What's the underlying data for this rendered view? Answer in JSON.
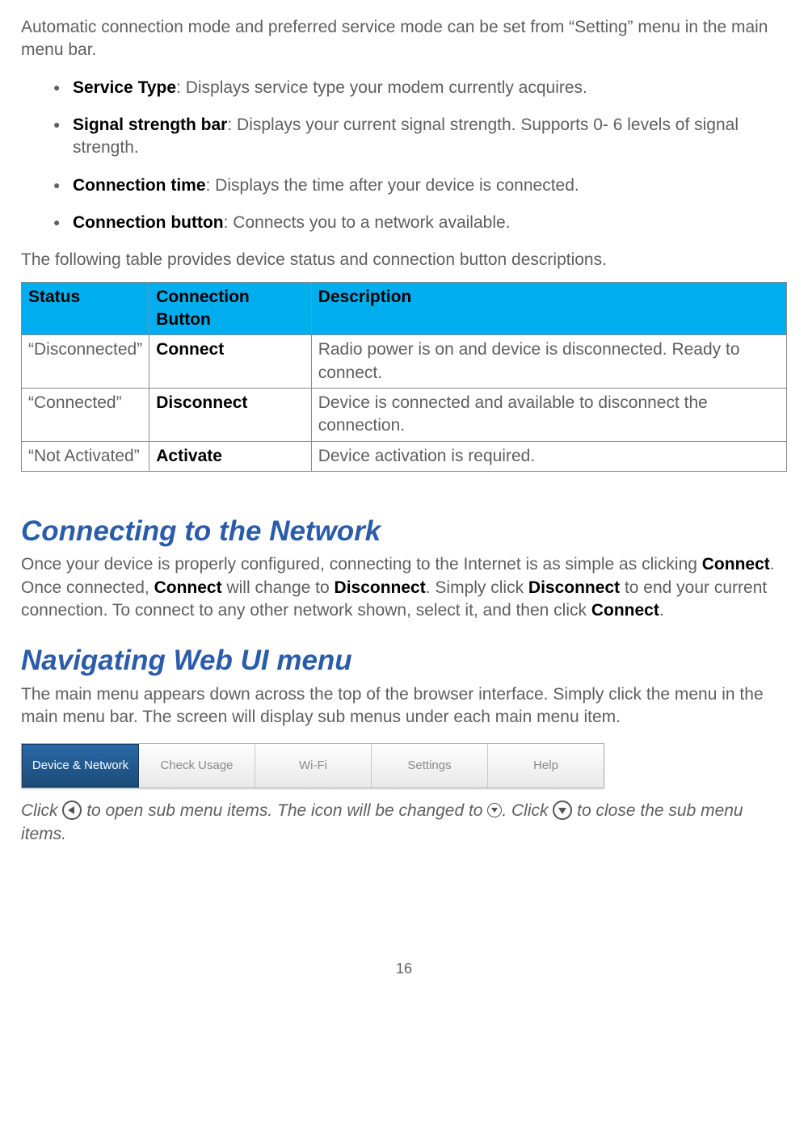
{
  "intro": "Automatic connection mode and preferred service mode can be set from “Setting” menu in the main menu bar.",
  "features": [
    {
      "label": "Service Type",
      "desc": ": Displays service type your modem currently acquires."
    },
    {
      "label": "Signal strength bar",
      "desc": ": Displays your current signal strength. Supports 0- 6 levels of signal strength."
    },
    {
      "label": "Connection time",
      "desc": ": Displays the time after your device is connected."
    },
    {
      "label": "Connection button",
      "desc": ": Connects you to a network available."
    }
  ],
  "table_intro": "The following table provides device status and connection button descriptions.",
  "table": {
    "headers": [
      "Status",
      "Connection Button",
      "Description"
    ],
    "rows": [
      {
        "status": "“Disconnected”",
        "button": "Connect",
        "desc": "Radio power is on and device is disconnected. Ready to connect."
      },
      {
        "status": "“Connected”",
        "button": "Disconnect",
        "desc": "Device is connected and available to disconnect the connection."
      },
      {
        "status": "“Not Activated”",
        "button": "Activate",
        "desc": "Device activation is required."
      }
    ]
  },
  "sections": {
    "connecting": {
      "heading": "Connecting to the Network",
      "para_parts": {
        "p1": "Once your device is properly configured, connecting to the Internet is as simple as clicking ",
        "b1": "Connect",
        "p2": ".  Once connected, ",
        "b2": "Connect",
        "p3": " will change to ",
        "b3": "Disconnect",
        "p4": ". Simply click ",
        "b4": "Disconnect",
        "p5": " to end your current connection. To connect to any other network shown, select it, and then click ",
        "b5": "Connect",
        "p6": "."
      }
    },
    "navigating": {
      "heading": "Navigating Web UI menu",
      "para": "The main menu appears down across the top of the browser interface. Simply click the menu in the main menu bar. The screen will display sub menus under each main menu item."
    }
  },
  "menu_tabs": [
    "Device & Network",
    "Check Usage",
    "Wi-Fi",
    "Settings",
    "Help"
  ],
  "submenu_note": {
    "p1": "Click ",
    "p2": " to open sub menu items. The icon will be changed to ",
    "p3": ". Click ",
    "p4": " to close the sub menu items."
  },
  "page_number": "16"
}
